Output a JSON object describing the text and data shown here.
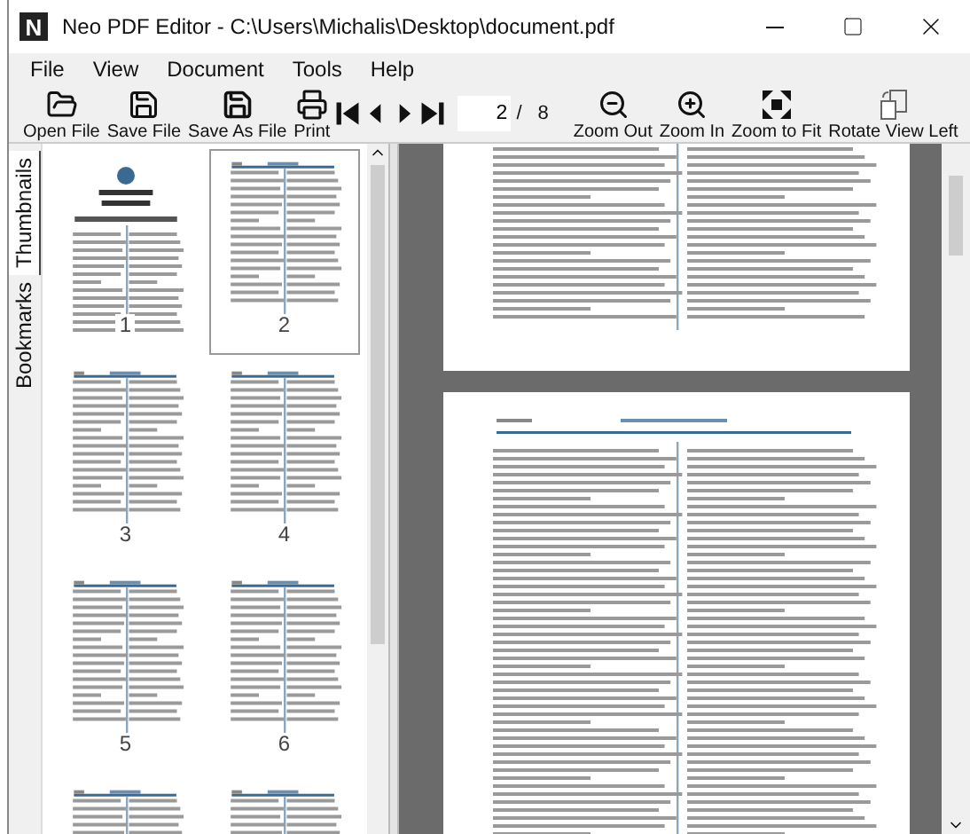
{
  "window": {
    "logo": "N",
    "title": "Neo PDF Editor - C:\\Users\\Michalis\\Desktop\\document.pdf"
  },
  "menu": [
    "File",
    "View",
    "Document",
    "Tools",
    "Help"
  ],
  "toolbar": [
    {
      "kind": "open",
      "label": "Open File"
    },
    {
      "kind": "save",
      "label": "Save File"
    },
    {
      "kind": "saveas",
      "label": "Save As File"
    },
    {
      "kind": "print",
      "label": "Print"
    }
  ],
  "navigation": {
    "page": "2",
    "separator": "/",
    "total": "8"
  },
  "view_tools": [
    {
      "kind": "zoomout",
      "label": "Zoom Out"
    },
    {
      "kind": "zoomin",
      "label": "Zoom In"
    },
    {
      "kind": "fit",
      "label": "Zoom to Fit"
    },
    {
      "kind": "rotate",
      "label": "Rotate View Left"
    }
  ],
  "side_tabs": [
    {
      "label": "Thumbnails",
      "selected": true
    },
    {
      "label": "Bookmarks",
      "selected": false
    }
  ],
  "thumbnails": [
    {
      "label": "1",
      "selected": false
    },
    {
      "label": "2",
      "selected": true
    },
    {
      "label": "3",
      "selected": false
    },
    {
      "label": "4",
      "selected": false
    },
    {
      "label": "5",
      "selected": false
    },
    {
      "label": "6",
      "selected": false
    },
    {
      "selected": false
    },
    {
      "selected": false
    }
  ]
}
